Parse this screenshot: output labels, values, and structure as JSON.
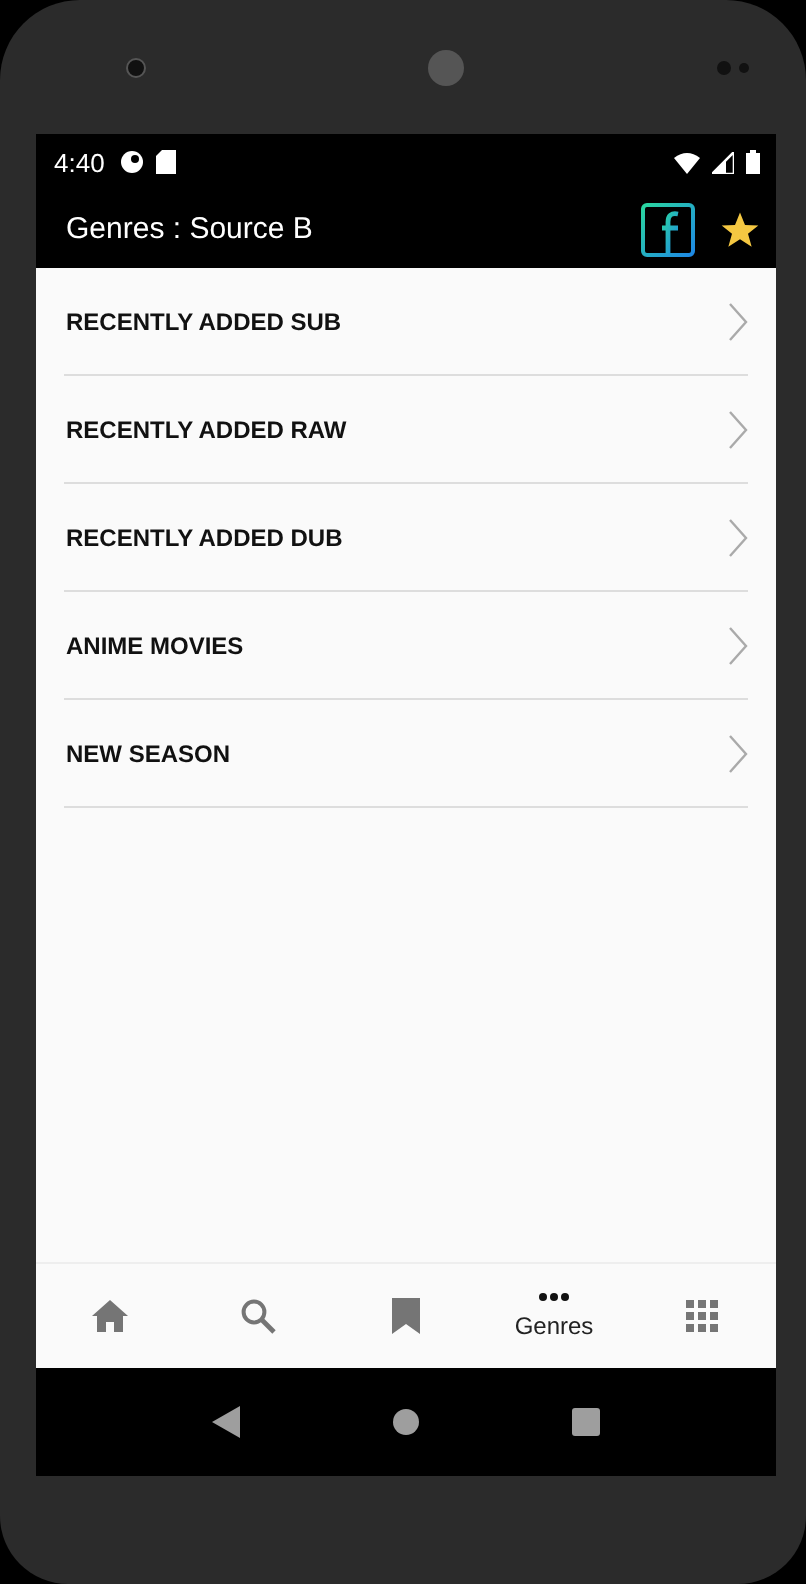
{
  "status_bar": {
    "time": "4:40"
  },
  "app_bar": {
    "title": "Genres : Source B"
  },
  "list": [
    {
      "label": "RECENTLY ADDED SUB"
    },
    {
      "label": "RECENTLY ADDED RAW"
    },
    {
      "label": "RECENTLY ADDED DUB"
    },
    {
      "label": "ANIME MOVIES"
    },
    {
      "label": "NEW SEASON"
    }
  ],
  "bottom_nav": [
    {
      "kind": "home",
      "selected": false
    },
    {
      "kind": "search",
      "selected": false
    },
    {
      "kind": "bookmark",
      "selected": false
    },
    {
      "kind": "more",
      "label": "Genres",
      "selected": true
    },
    {
      "kind": "apps",
      "selected": false
    }
  ]
}
